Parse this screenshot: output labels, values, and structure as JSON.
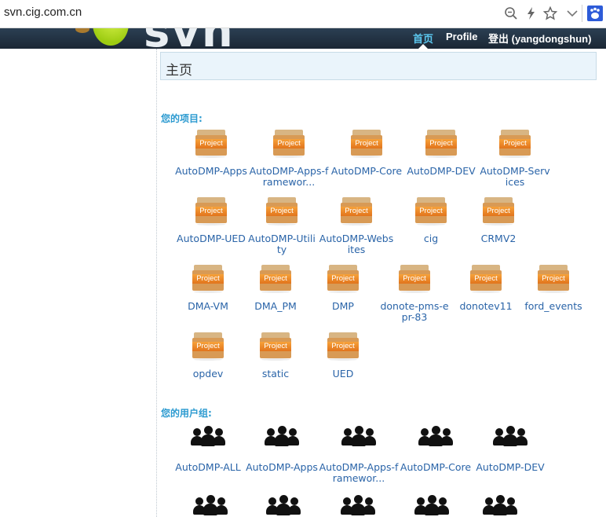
{
  "browser": {
    "url": "svn.cig.com.cn",
    "icons": [
      "zoom-icon",
      "bolt-icon",
      "star-icon",
      "chevron-down-icon",
      "baidu-icon"
    ]
  },
  "header": {
    "logo_text": "svn",
    "nav": {
      "home": "首页",
      "profile": "Profile",
      "logout": "登出 (yangdongshun)"
    }
  },
  "main": {
    "title": "主页",
    "projects_heading": "您的项目:",
    "project_icon_text": "Project",
    "projects": [
      "AutoDMP-Apps",
      "AutoDMP-Apps-framewor...",
      "AutoDMP-Core",
      "AutoDMP-DEV",
      "AutoDMP-Services",
      "AutoDMP-UED",
      "AutoDMP-Utility",
      "AutoDMP-Websites",
      "cig",
      "CRMV2",
      "DMA-VM",
      "DMA_PM",
      "DMP",
      "donote-pms-epr-83",
      "donotev11",
      "ford_events",
      "opdev",
      "static",
      "UED"
    ],
    "groups_heading": "您的用户组:",
    "groups": [
      "AutoDMP-ALL",
      "AutoDMP-Apps",
      "AutoDMP-Apps-framewor...",
      "AutoDMP-Core",
      "AutoDMP-DEV"
    ]
  },
  "colors": {
    "link": "#2a64a8",
    "section": "#2b9ad0",
    "header_bg": "#1f2d3b",
    "nav_active": "#5cc8f0"
  }
}
